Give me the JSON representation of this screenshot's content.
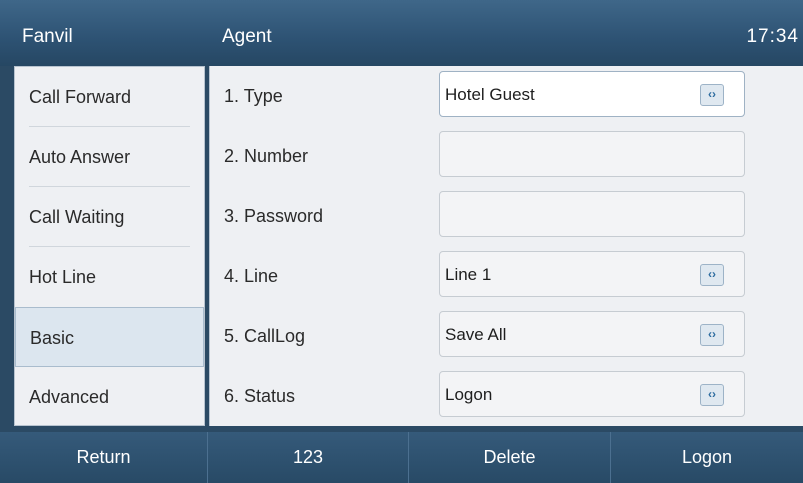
{
  "header": {
    "brand": "Fanvil",
    "title": "Agent",
    "time": "17:34"
  },
  "sidebar": {
    "items": [
      {
        "label": "Call Forward",
        "selected": false
      },
      {
        "label": "Auto Answer",
        "selected": false
      },
      {
        "label": "Call Waiting",
        "selected": false
      },
      {
        "label": "Hot Line",
        "selected": false
      },
      {
        "label": "Basic",
        "selected": true
      },
      {
        "label": "Advanced",
        "selected": false
      }
    ]
  },
  "form": {
    "rows": [
      {
        "label": "1. Type",
        "value": "Hotel Guest",
        "has_selector": true,
        "active": true
      },
      {
        "label": "2. Number",
        "value": "",
        "has_selector": false,
        "active": false
      },
      {
        "label": "3. Password",
        "value": "",
        "has_selector": false,
        "active": false
      },
      {
        "label": "4. Line",
        "value": "Line 1",
        "has_selector": true,
        "active": false
      },
      {
        "label": "5. CallLog",
        "value": "Save All",
        "has_selector": true,
        "active": false
      },
      {
        "label": "6. Status",
        "value": "Logon",
        "has_selector": true,
        "active": false
      }
    ],
    "selector_glyph": "‹›"
  },
  "softkeys": [
    "Return",
    "123",
    "Delete",
    "Logon"
  ],
  "colors": {
    "header_bg": "#2d5273",
    "panel_bg": "#eef0f3",
    "selected_bg": "#dce6ef",
    "selector_accent": "#2f6da0"
  }
}
